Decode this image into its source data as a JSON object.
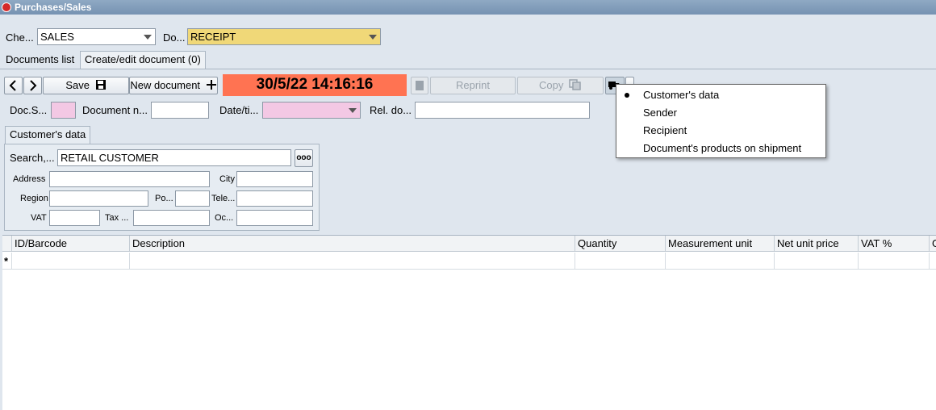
{
  "window": {
    "title": "Purchases/Sales"
  },
  "top_bar": {
    "che_label": "Che...",
    "che_value": "SALES",
    "do_label": "Do...",
    "do_value": "RECEIPT"
  },
  "tabs": [
    {
      "label": "Documents list"
    },
    {
      "label": "Create/edit document (0)"
    }
  ],
  "toolbar": {
    "save_label": "Save",
    "new_document_label": "New document",
    "datetime": "30/5/22 14:16:16",
    "reprint_label": "Reprint",
    "copy_label": "Copy"
  },
  "doc_fields": {
    "doc_s_label": "Doc.S...",
    "document_n_label": "Document n...",
    "date_label": "Date/ti...",
    "rel_do_label": "Rel. do..."
  },
  "customer": {
    "tab_label": "Customer's data",
    "search_label": "Search,...",
    "search_value": "RETAIL CUSTOMER",
    "more_button": "ooo",
    "address_label": "Address",
    "city_label": "City",
    "region_label": "Region",
    "po_label": "Po...",
    "tele_label": "Tele...",
    "vat_label": "VAT",
    "tax_label": "Tax ...",
    "oc_label": "Oc..."
  },
  "grid": {
    "columns": [
      "ID/Barcode",
      "Description",
      "Quantity",
      "Measurement unit",
      "Net unit price",
      "VAT %",
      "G"
    ],
    "new_row_marker": "*"
  },
  "popup_menu": {
    "items": [
      {
        "label": "Customer's data",
        "selected": true
      },
      {
        "label": "Sender",
        "selected": false
      },
      {
        "label": "Recipient",
        "selected": false
      },
      {
        "label": "Document's products on shipment",
        "selected": false
      }
    ]
  },
  "colors": {
    "highlight_yellow": "#f0d878",
    "clock_bg": "#ff7352",
    "pink_field": "#f3c8e4"
  }
}
